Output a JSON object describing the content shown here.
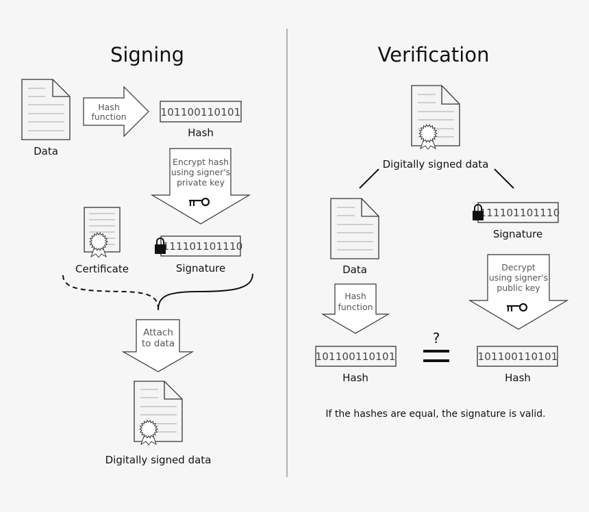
{
  "signing": {
    "title": "Signing",
    "data_label": "Data",
    "hash_arrow": [
      "Hash",
      "function"
    ],
    "hash_value": "101100110101",
    "hash_label": "Hash",
    "encrypt_arrow": [
      "Encrypt hash",
      "using signer's",
      "private key"
    ],
    "certificate_label": "Certificate",
    "signature_value": "111101101110",
    "signature_label": "Signature",
    "attach_arrow": [
      "Attach",
      "to data"
    ],
    "signed_label": "Digitally signed data"
  },
  "verification": {
    "title": "Verification",
    "signed_label": "Digitally signed data",
    "data_label": "Data",
    "signature_value": "111101101110",
    "signature_label": "Signature",
    "hash_arrow": [
      "Hash",
      "function"
    ],
    "decrypt_arrow": [
      "Decrypt",
      "using signer's",
      "public key"
    ],
    "left_hash_value": "101100110101",
    "left_hash_label": "Hash",
    "right_hash_value": "101100110101",
    "right_hash_label": "Hash",
    "compare_symbol": "?",
    "conclusion": "If the hashes are equal, the signature is valid."
  },
  "icons": [
    "document-icon",
    "certificate-icon",
    "key-icon",
    "lock-icon",
    "seal-icon",
    "arrow-icon",
    "equals-icon"
  ]
}
